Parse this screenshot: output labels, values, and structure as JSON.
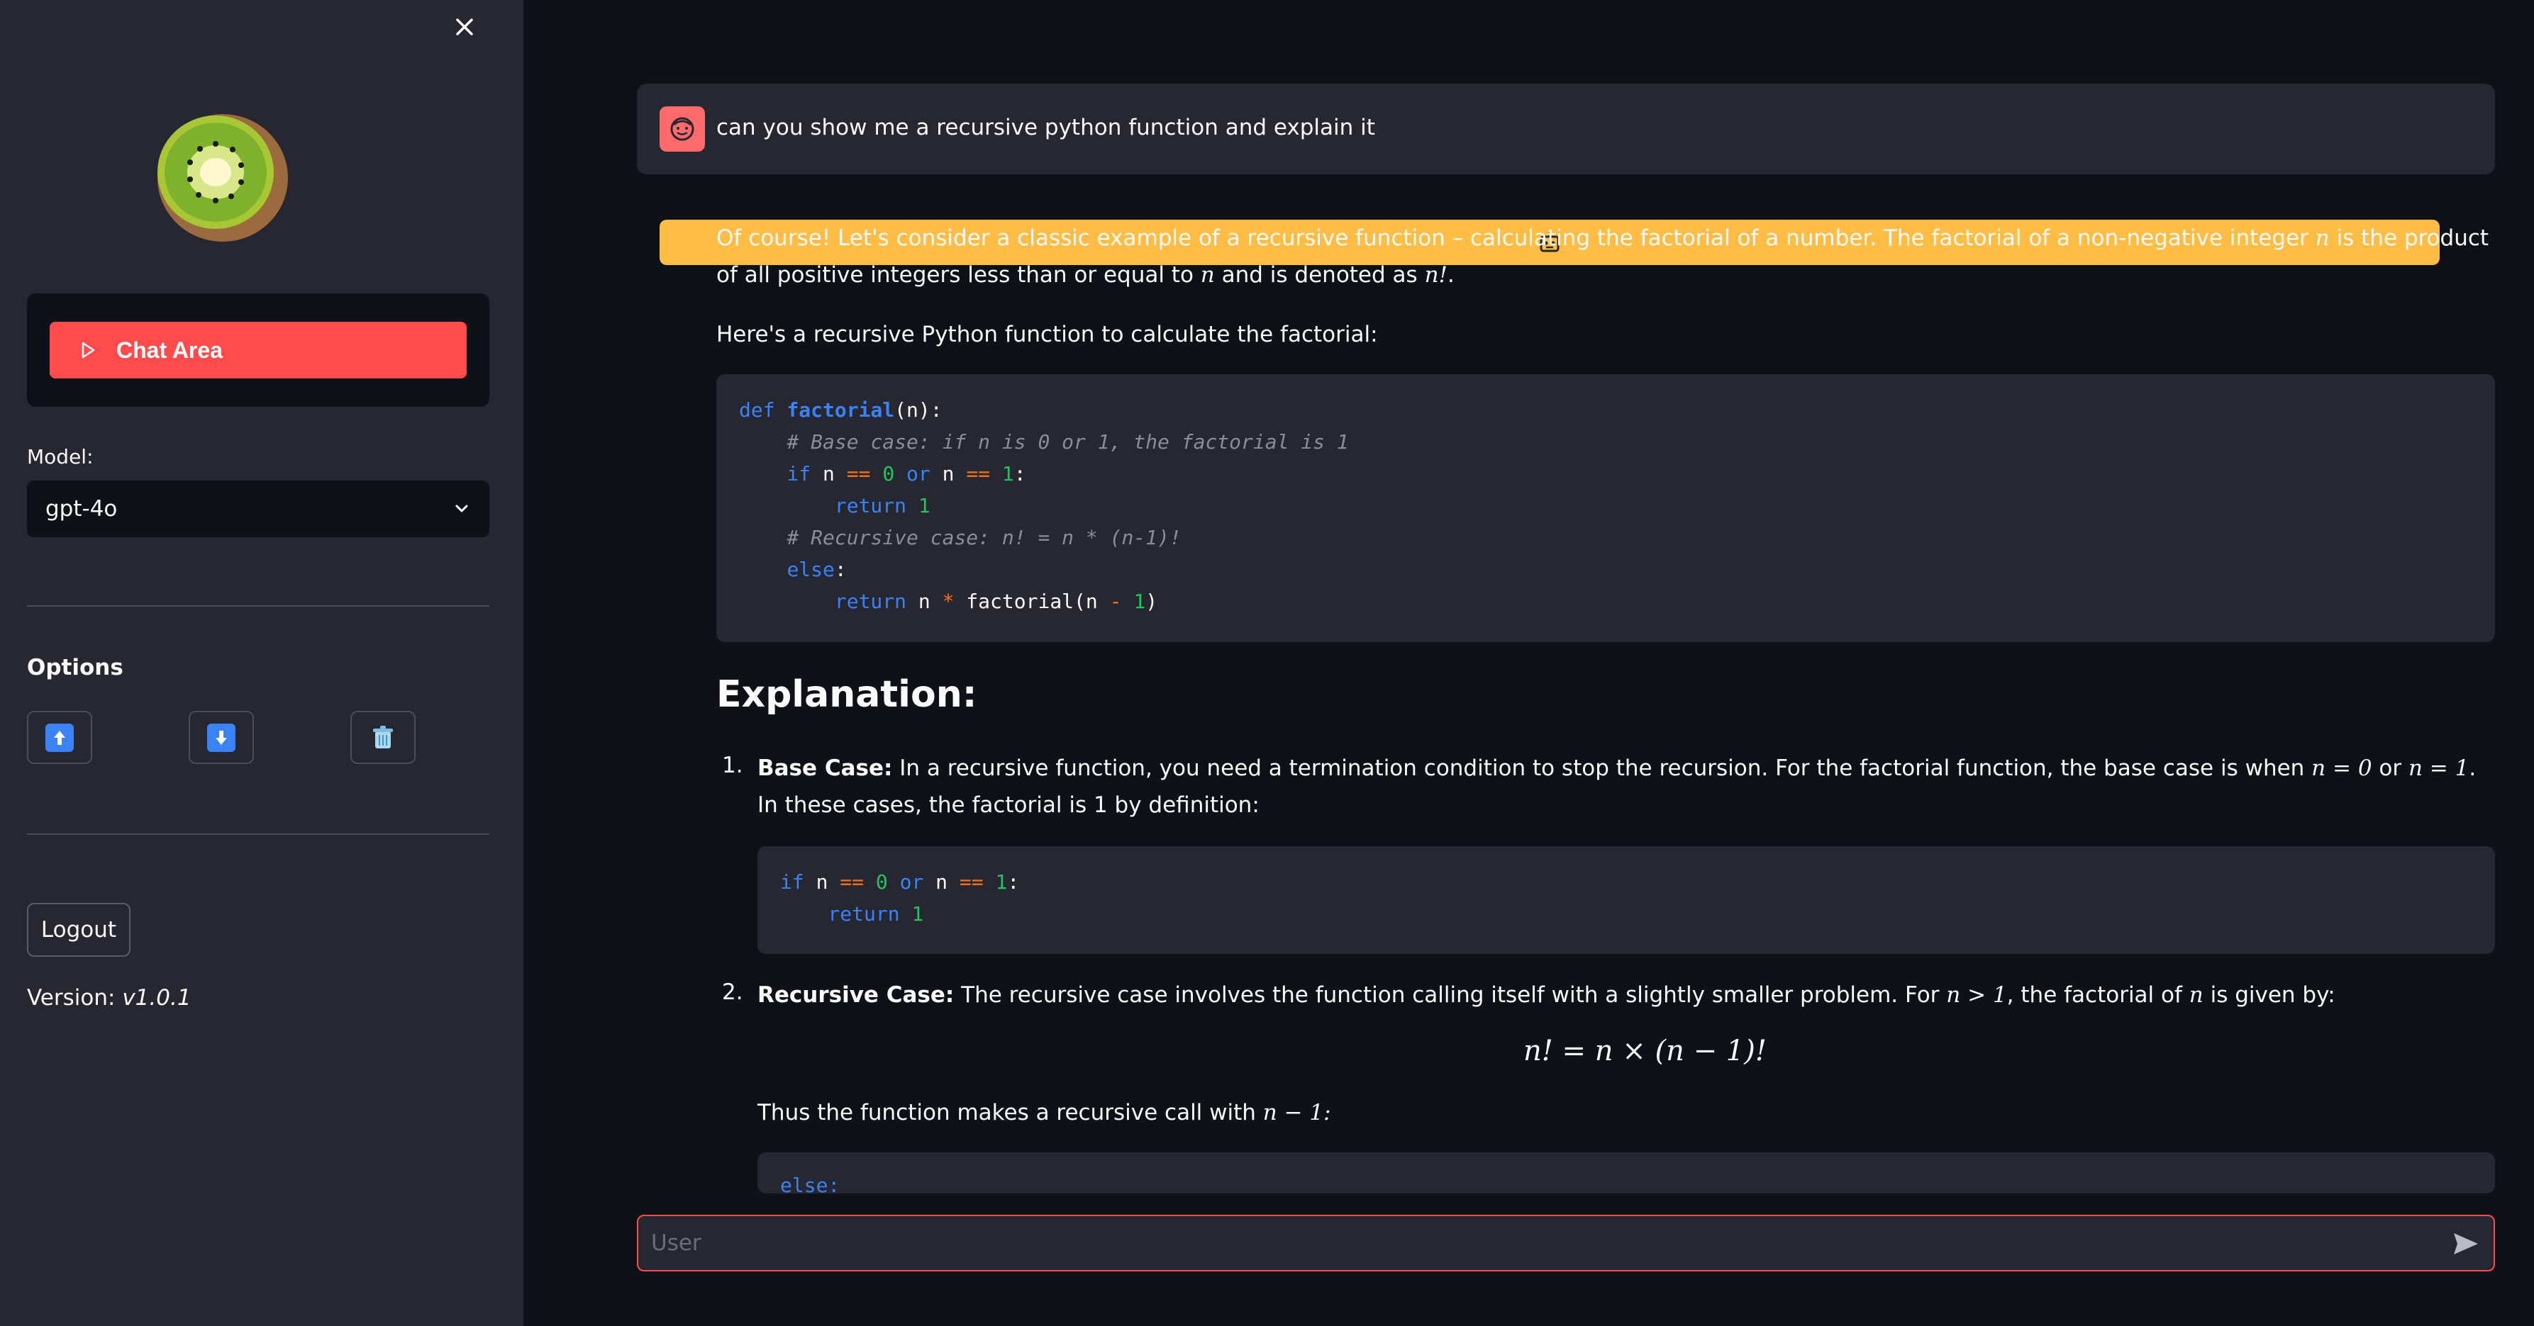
{
  "sidebar": {
    "nav_label": "Chat Area",
    "model_label": "Model:",
    "model_value": "gpt-4o",
    "options_title": "Options",
    "logout_label": "Logout",
    "version_prefix": "Version:",
    "version_value": "v1.0.1",
    "option_icons": [
      "upload-icon",
      "download-icon",
      "trash-icon"
    ]
  },
  "chat": {
    "user_message": "can you show me a recursive python function and explain it",
    "bot_intro_1": "Of course! Let's consider a classic example of a recursive function – calculating the factorial of a number. The factorial of a non-negative integer",
    "bot_intro_2": "is the product of all positive integers less than or equal to",
    "bot_intro_3": "and is denoted as",
    "bot_intro_4": "Here's a recursive Python function to calculate the factorial:",
    "heading": "Explanation:",
    "item1_title": "Base Case:",
    "item1_text": "In a recursive function, you need a termination condition to stop the recursion. For the factorial function, the base case is when",
    "item1_text2": "In these cases, the factorial is 1 by definition:",
    "item2_title": "Recursive Case:",
    "item2_text": "The recursive case involves the function calling itself with a slightly smaller problem. For",
    "item2_text2": "the factorial of",
    "item2_text3": "is given by:",
    "formula": "n! = n × (n − 1)!",
    "thus_text": "Thus the function makes a recursive call with",
    "thus_math": "n − 1:",
    "partial_code": "else:"
  },
  "input": {
    "placeholder": "User"
  },
  "colors": {
    "accent": "#ff4b4b",
    "sidebar_bg": "#262730",
    "main_bg": "#0e1117"
  }
}
